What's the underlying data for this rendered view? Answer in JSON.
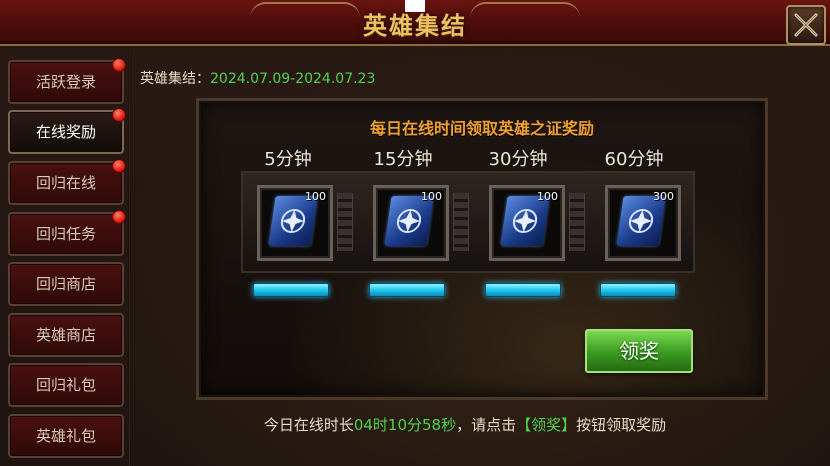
{
  "header": {
    "title": "英雄集结",
    "close_icon": "close-icon"
  },
  "sidebar": {
    "items": [
      {
        "label": "活跃登录",
        "badge": true,
        "active": false
      },
      {
        "label": "在线奖励",
        "badge": true,
        "active": true
      },
      {
        "label": "回归在线",
        "badge": true,
        "active": false
      },
      {
        "label": "回归任务",
        "badge": true,
        "active": false
      },
      {
        "label": "回归商店",
        "badge": false,
        "active": false
      },
      {
        "label": "英雄商店",
        "badge": false,
        "active": false
      },
      {
        "label": "回归礼包",
        "badge": false,
        "active": false
      },
      {
        "label": "英雄礼包",
        "badge": false,
        "active": false
      }
    ]
  },
  "event": {
    "label": "英雄集结：",
    "date_range": "2024.07.09-2024.07.23"
  },
  "panel": {
    "title": "每日在线时间领取英雄之证奖励",
    "rewards": [
      {
        "time": "5分钟",
        "qty": "100",
        "icon": "hero-token-icon",
        "progress": 1.0
      },
      {
        "time": "15分钟",
        "qty": "100",
        "icon": "hero-token-icon",
        "progress": 1.0
      },
      {
        "time": "30分钟",
        "qty": "100",
        "icon": "hero-token-icon",
        "progress": 1.0
      },
      {
        "time": "60分钟",
        "qty": "300",
        "icon": "hero-token-icon",
        "progress": 1.0
      }
    ],
    "claim_label": "领奖"
  },
  "footer": {
    "prefix": "今日在线时长",
    "time": "04时10分58秒",
    "middle": "，请点击",
    "bracket_text": "【领奖】",
    "suffix": "按钮领取奖励"
  },
  "colors": {
    "accent_green": "#4ed34e",
    "title_gold": "#f0c060",
    "progress_cyan": "#20c8f0"
  }
}
